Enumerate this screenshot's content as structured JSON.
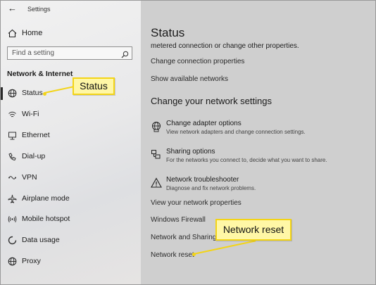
{
  "window": {
    "title": "Settings"
  },
  "sidebar": {
    "home_label": "Home",
    "search_placeholder": "Find a setting",
    "section_title": "Network & Internet",
    "items": [
      {
        "label": "Status",
        "icon": "globe-icon",
        "active": true
      },
      {
        "label": "Wi-Fi",
        "icon": "wifi-icon"
      },
      {
        "label": "Ethernet",
        "icon": "ethernet-icon"
      },
      {
        "label": "Dial-up",
        "icon": "dialup-icon"
      },
      {
        "label": "VPN",
        "icon": "vpn-icon"
      },
      {
        "label": "Airplane mode",
        "icon": "airplane-icon"
      },
      {
        "label": "Mobile hotspot",
        "icon": "hotspot-icon"
      },
      {
        "label": "Data usage",
        "icon": "data-usage-icon"
      },
      {
        "label": "Proxy",
        "icon": "proxy-globe-icon"
      }
    ]
  },
  "main": {
    "title": "Status",
    "metered_text": "metered connection or change other properties.",
    "links_top": [
      "Change connection properties",
      "Show available networks"
    ],
    "subheading": "Change your network settings",
    "options": [
      {
        "title": "Change adapter options",
        "desc": "View network adapters and change connection settings.",
        "icon": "adapter-icon"
      },
      {
        "title": "Sharing options",
        "desc": "For the networks you connect to, decide what you want to share.",
        "icon": "sharing-icon"
      },
      {
        "title": "Network troubleshooter",
        "desc": "Diagnose and fix network problems.",
        "icon": "warning-icon"
      }
    ],
    "links_bottom": [
      "View your network properties",
      "Windows Firewall",
      "Network and Sharing C",
      "Network reset"
    ]
  },
  "callouts": {
    "status": "Status",
    "network_reset": "Network reset"
  },
  "colors": {
    "callout_fill": "#fff7a6",
    "callout_border": "#f3d417",
    "overlay": "#cfcfcf"
  }
}
